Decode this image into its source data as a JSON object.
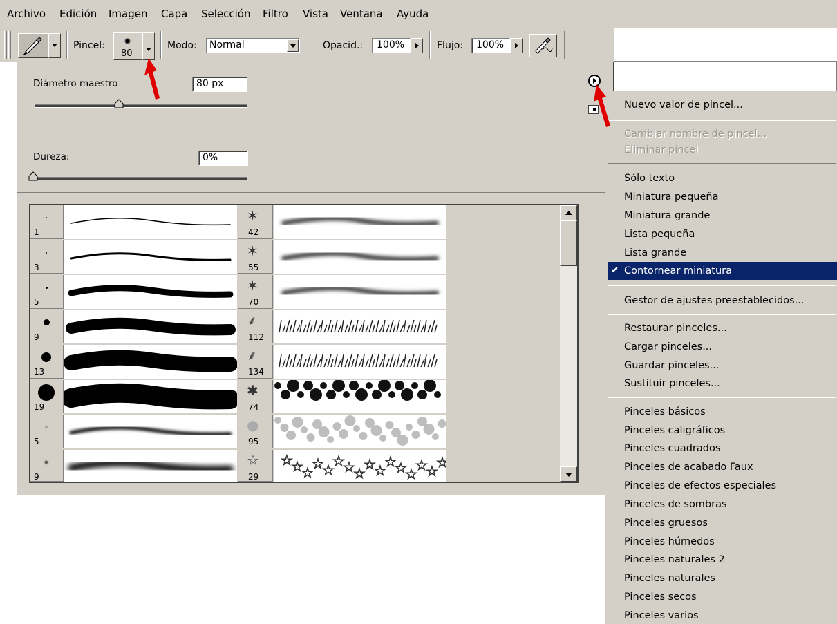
{
  "menubar": {
    "items": [
      "Archivo",
      "Edición",
      "Imagen",
      "Capa",
      "Selección",
      "Filtro",
      "Vista",
      "Ventana",
      "Ayuda"
    ]
  },
  "options": {
    "brush_label": "Pincel:",
    "brush_size": "80",
    "mode_label": "Modo:",
    "mode_value": "Normal",
    "opacity_label": "Opacid.:",
    "opacity_value": "100%",
    "flow_label": "Flujo:",
    "flow_value": "100%"
  },
  "panel": {
    "diameter_label": "Diámetro maestro",
    "diameter_value": "80 px",
    "diameter_slider_fraction": 0.4,
    "hardness_label": "Dureza:",
    "hardness_value": "0%",
    "hardness_slider_fraction": 0.0,
    "brushes_col1": [
      "1",
      "3",
      "5",
      "9",
      "13",
      "19",
      "5",
      "9"
    ],
    "brushes_col2": [
      "42",
      "55",
      "70",
      "112",
      "134",
      "74",
      "95",
      "29"
    ]
  },
  "flyout": {
    "items": [
      {
        "label": "Nuevo valor de pincel...",
        "enabled": true
      },
      {
        "label": "Cambiar nombre de pincel...",
        "enabled": false
      },
      {
        "label": "Eliminar pincel",
        "enabled": false
      },
      {
        "label": "Sólo texto",
        "enabled": true
      },
      {
        "label": "Miniatura pequeña",
        "enabled": true
      },
      {
        "label": "Miniatura grande",
        "enabled": true
      },
      {
        "label": "Lista pequeña",
        "enabled": true
      },
      {
        "label": "Lista grande",
        "enabled": true
      },
      {
        "label": "Contornear miniatura",
        "enabled": true,
        "checked": true
      },
      {
        "label": "Gestor de ajustes preestablecidos...",
        "enabled": true
      },
      {
        "label": "Restaurar pinceles...",
        "enabled": true
      },
      {
        "label": "Cargar pinceles...",
        "enabled": true
      },
      {
        "label": "Guardar pinceles...",
        "enabled": true
      },
      {
        "label": "Sustituir pinceles...",
        "enabled": true
      },
      {
        "label": "Pinceles básicos",
        "enabled": true
      },
      {
        "label": "Pinceles caligráficos",
        "enabled": true
      },
      {
        "label": "Pinceles cuadrados",
        "enabled": true
      },
      {
        "label": "Pinceles de acabado Faux",
        "enabled": true
      },
      {
        "label": "Pinceles de efectos especiales",
        "enabled": true
      },
      {
        "label": "Pinceles de sombras",
        "enabled": true
      },
      {
        "label": "Pinceles gruesos",
        "enabled": true
      },
      {
        "label": "Pinceles húmedos",
        "enabled": true
      },
      {
        "label": "Pinceles naturales 2",
        "enabled": true
      },
      {
        "label": "Pinceles naturales",
        "enabled": true
      },
      {
        "label": "Pinceles secos",
        "enabled": true
      },
      {
        "label": "Pinceles varios",
        "enabled": true
      }
    ]
  },
  "colors": {
    "chrome": "#d4d0c8",
    "selection": "#0a246a",
    "annotation_arrow": "#e00000"
  }
}
